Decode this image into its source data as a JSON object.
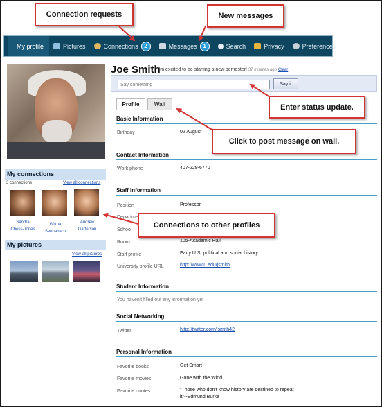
{
  "nav": {
    "items": [
      {
        "label": "My profile",
        "icon": "profile-icon"
      },
      {
        "label": "Pictures",
        "icon": "pictures-icon"
      },
      {
        "label": "Connections",
        "icon": "connections-icon",
        "badge": "2"
      },
      {
        "label": "Messages",
        "icon": "messages-icon",
        "badge": "1"
      },
      {
        "label": "Search",
        "icon": "search-icon"
      },
      {
        "label": "Privacy",
        "icon": "lock-icon"
      },
      {
        "label": "Preferences",
        "icon": "gear-icon"
      }
    ]
  },
  "profile": {
    "name": "Joe Smith",
    "status": "I'm excited to be starting a new semester!",
    "status_time": "37 minutes ago",
    "clear_label": "Clear",
    "status_placeholder": "Say something",
    "say_label": "Say it"
  },
  "tabs": {
    "profile": "Profile",
    "wall": "Wall"
  },
  "sidebar": {
    "connections_title": "My connections",
    "connections_count": "3 connections",
    "view_all_connections": "View all connections",
    "connections": [
      {
        "first": "Sandra",
        "last": "Chess-Jones"
      },
      {
        "first": "Wilma",
        "last": "Sennabach"
      },
      {
        "first": "Andrew",
        "last": "Garterson"
      }
    ],
    "pictures_title": "My pictures",
    "view_all_pictures": "View all pictures"
  },
  "sections": {
    "basic": {
      "title": "Basic Information",
      "birthday_label": "Birthday",
      "birthday": "02 August"
    },
    "contact": {
      "title": "Contact Information",
      "work_phone_label": "Work phone",
      "work_phone": "407-229-6770"
    },
    "staff": {
      "title": "Staff Information",
      "position_label": "Position",
      "position": "Professor",
      "department_label": "Department",
      "school_label": "School",
      "room_label": "Room",
      "room": "105-Academic Hall",
      "staff_profile_label": "Staff profile",
      "staff_profile": "Early U.S. political and social history",
      "url_label": "University profile URL",
      "url": "http://www.u.edu/jsmith"
    },
    "student": {
      "title": "Student Information",
      "empty": "You haven't filled out any information yet"
    },
    "social": {
      "title": "Social Networking",
      "twitter_label": "Twitter",
      "twitter": "http://twitter.com/jsmith42"
    },
    "personal": {
      "title": "Personal Information",
      "books_label": "Favorite books",
      "books": "Get Smart",
      "movies_label": "Favorite movies",
      "movies": "Gone with the Wind",
      "quotes_label": "Favorite quotes",
      "quotes_1": "\"Those who don't know history are destined to repeat",
      "quotes_2": "it\"--Edmund Burke"
    }
  },
  "callouts": {
    "connection_requests": "Connection requests",
    "new_messages": "New messages",
    "status_update": "Enter status update.",
    "post_wall": "Click to post message on wall.",
    "connections_profiles": "Connections to other profiles"
  },
  "colors": {
    "nav_bg": "#0e4660",
    "badge": "#2a9bd6",
    "callout_border": "#d43333",
    "section_rule": "#4a9fc6"
  }
}
